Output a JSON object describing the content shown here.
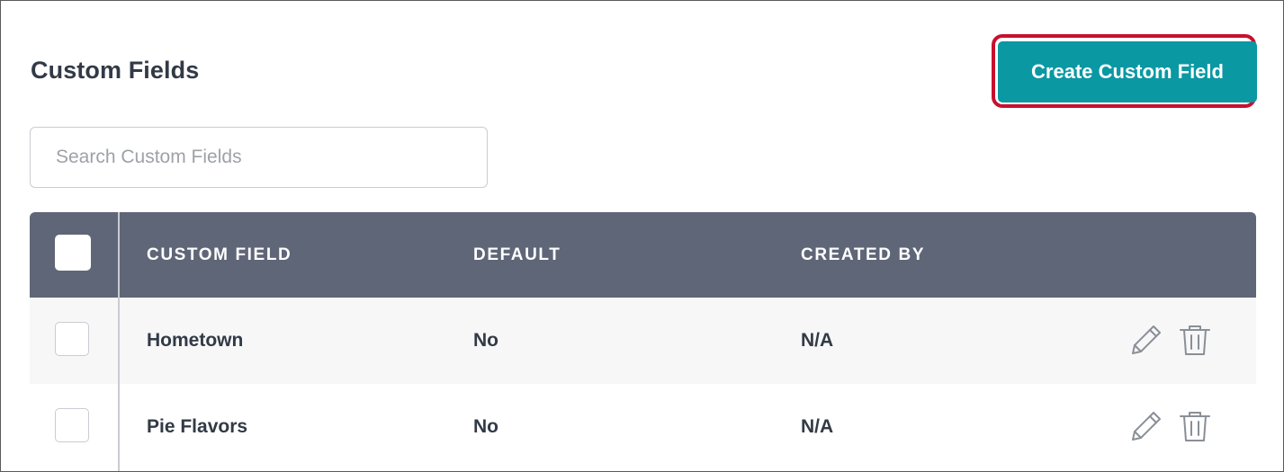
{
  "page": {
    "title": "Custom Fields"
  },
  "actions": {
    "create_label": "Create Custom Field"
  },
  "search": {
    "placeholder": "Search Custom Fields",
    "value": ""
  },
  "table": {
    "columns": [
      "CUSTOM FIELD",
      "DEFAULT",
      "CREATED BY"
    ],
    "rows": [
      {
        "name": "Hometown",
        "default": "No",
        "created_by": "N/A"
      },
      {
        "name": "Pie Flavors",
        "default": "No",
        "created_by": "N/A"
      }
    ],
    "row_icons": [
      "pencil-icon",
      "trash-icon"
    ]
  },
  "colors": {
    "accent": "#0a98a3",
    "highlight": "#c8102e",
    "header_bg": "#5f6677"
  }
}
